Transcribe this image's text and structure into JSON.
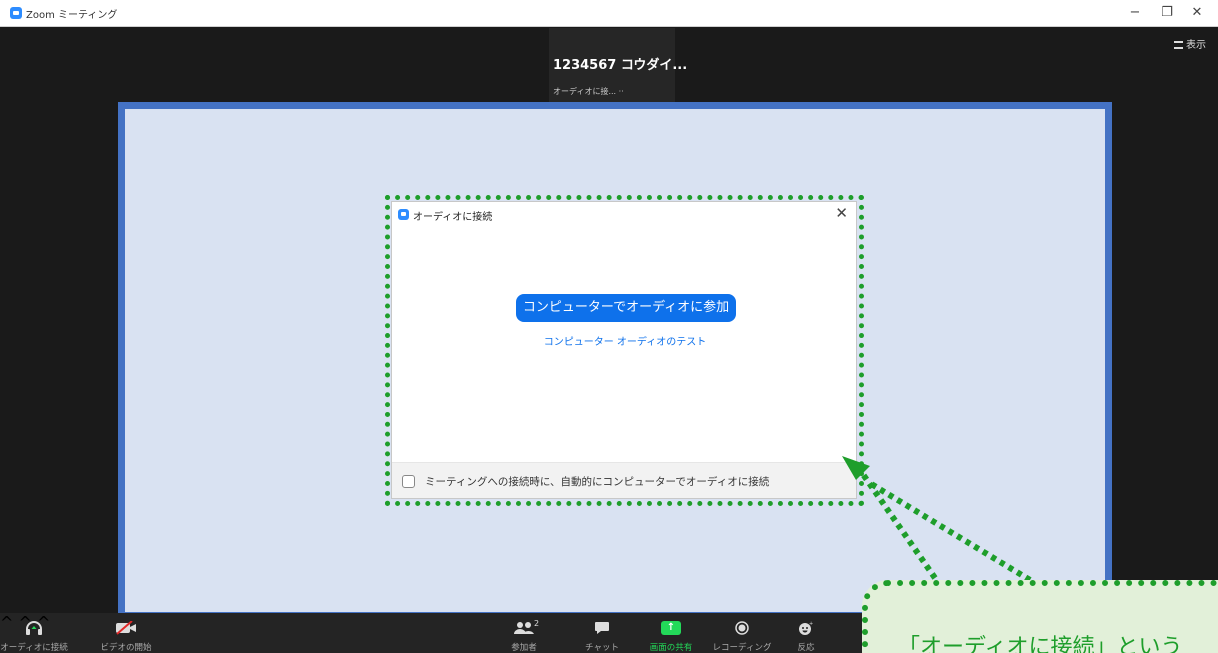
{
  "window": {
    "title": "Zoom ミーティング",
    "minimize": "−",
    "restore": "❐",
    "close": "✕"
  },
  "meeting": {
    "view_label": "表示",
    "participant_name": "1234567 コウダイ...",
    "participant_status": "オーディオに接... ··"
  },
  "dialog": {
    "title": "オーディオに接続",
    "close": "✕",
    "join_button": "コンピューターでオーディオに参加",
    "test_link": "コンピューター オーディオのテスト",
    "auto_join_checkbox": "ミーティングへの接続時に、自動的にコンピューターでオーディオに接続",
    "auto_join_checked": false
  },
  "toolbar": {
    "audio": "オーディオに接続",
    "video": "ビデオの開始",
    "participants": "参加者",
    "participant_count": "2",
    "chat": "チャット",
    "share": "画面の共有",
    "record": "レコーディング",
    "reactions": "反応",
    "caret": "^"
  },
  "callout": {
    "text": "「オーディオに接続」という"
  },
  "colors": {
    "accent_blue": "#0e71eb",
    "share_green": "#23d959",
    "highlight_green": "#1e9e2b",
    "frame_blue": "#4472c4"
  }
}
